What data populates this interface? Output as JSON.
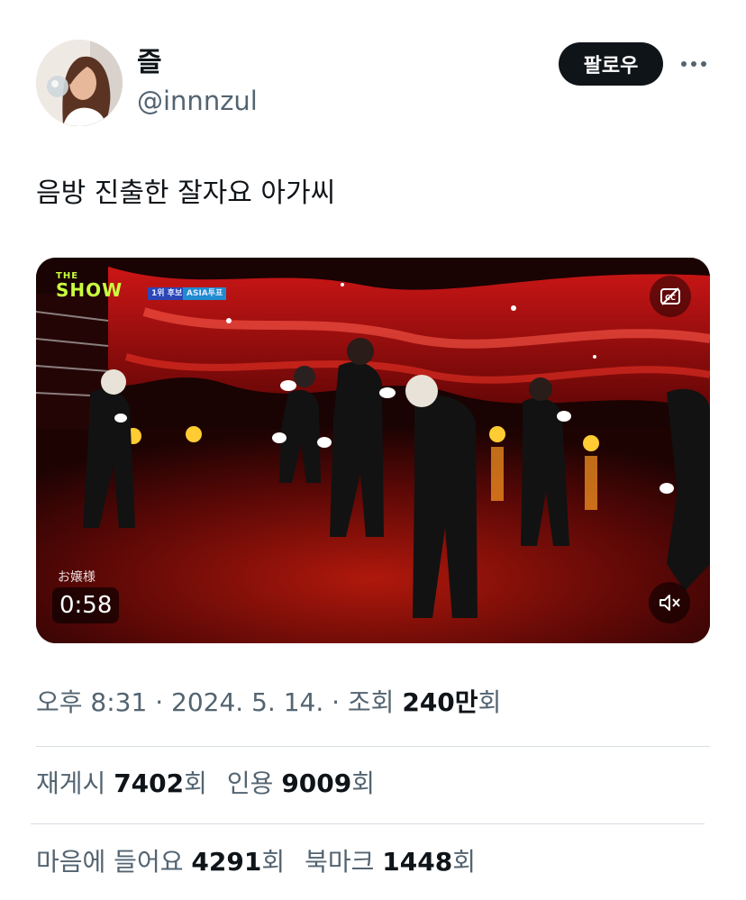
{
  "author": {
    "display_name": "즐",
    "handle": "@innnzul"
  },
  "header": {
    "follow_label": "팔로우",
    "more_icon": "more-horizontal-icon"
  },
  "tweet": {
    "text": "음방 진출한 잘자요 아가씨"
  },
  "video": {
    "logo_small": "THE",
    "logo_big": "SHOW",
    "badge_a": "1위 후보",
    "badge_b": "ASIA투표",
    "caption": "お嬢様",
    "duration": "0:58",
    "cc_icon": "captions-off-icon",
    "mute_icon": "muted-speaker-icon"
  },
  "meta": {
    "time": "오후 8:31",
    "sep1": " · ",
    "date": "2024. 5. 14.",
    "sep2": " · ",
    "views_prefix": "조회 ",
    "views_value": "240만",
    "views_suffix": "회"
  },
  "stats": {
    "retweets_label": "재게시 ",
    "retweets_value": "7402",
    "retweets_suffix": "회",
    "quotes_label": "인용 ",
    "quotes_value": "9009",
    "quotes_suffix": "회",
    "likes_label": "마음에 들어요 ",
    "likes_value": "4291",
    "likes_suffix": "회",
    "bookmarks_label": "북마크 ",
    "bookmarks_value": "1448",
    "bookmarks_suffix": "회"
  },
  "colors": {
    "text_primary": "#0f1419",
    "text_secondary": "#536471",
    "divider": "#d7dee3",
    "follow_bg": "#0f1419",
    "stage_red": "#c01010"
  }
}
